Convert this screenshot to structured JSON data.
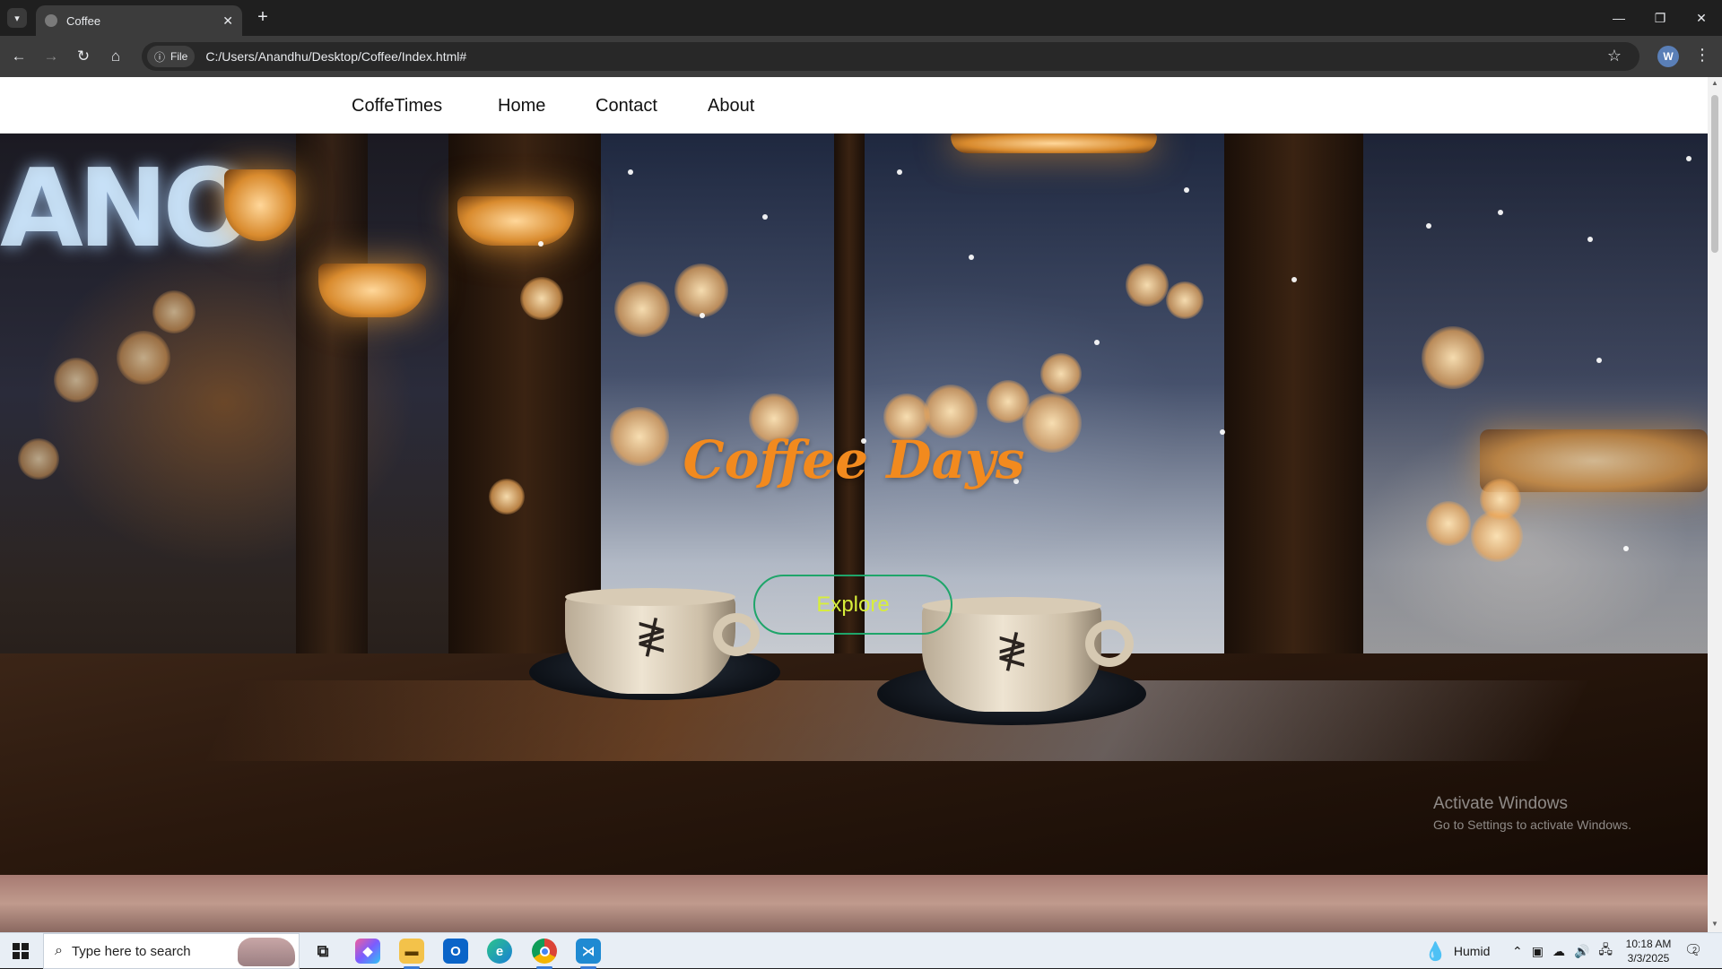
{
  "browser": {
    "tab_title": "Coffee",
    "new_tab_label": "+",
    "file_chip_label": "File",
    "url": "C:/Users/Anandhu/Desktop/Coffee/Index.html#"
  },
  "site": {
    "nav": {
      "brand": "CoffeTimes",
      "home": "Home",
      "contact": "Contact",
      "about": "About"
    },
    "hero": {
      "title": "Coffee Days",
      "explore_label": "Explore",
      "background_image": "coffee-cups-snowy-window-photo"
    }
  },
  "watermark": {
    "line1": "Activate Windows",
    "line2": "Go to Settings to activate Windows."
  },
  "taskbar": {
    "search_placeholder": "Type here to search",
    "weather": "Humid",
    "time": "10:18 AM",
    "date": "3/3/2025",
    "notification_count": "2"
  },
  "colors": {
    "hero_title": "#f28a1e",
    "explore_text": "#d8ee3a",
    "explore_border": "#1fa56a",
    "browser_chrome": "#3c3c3c"
  }
}
